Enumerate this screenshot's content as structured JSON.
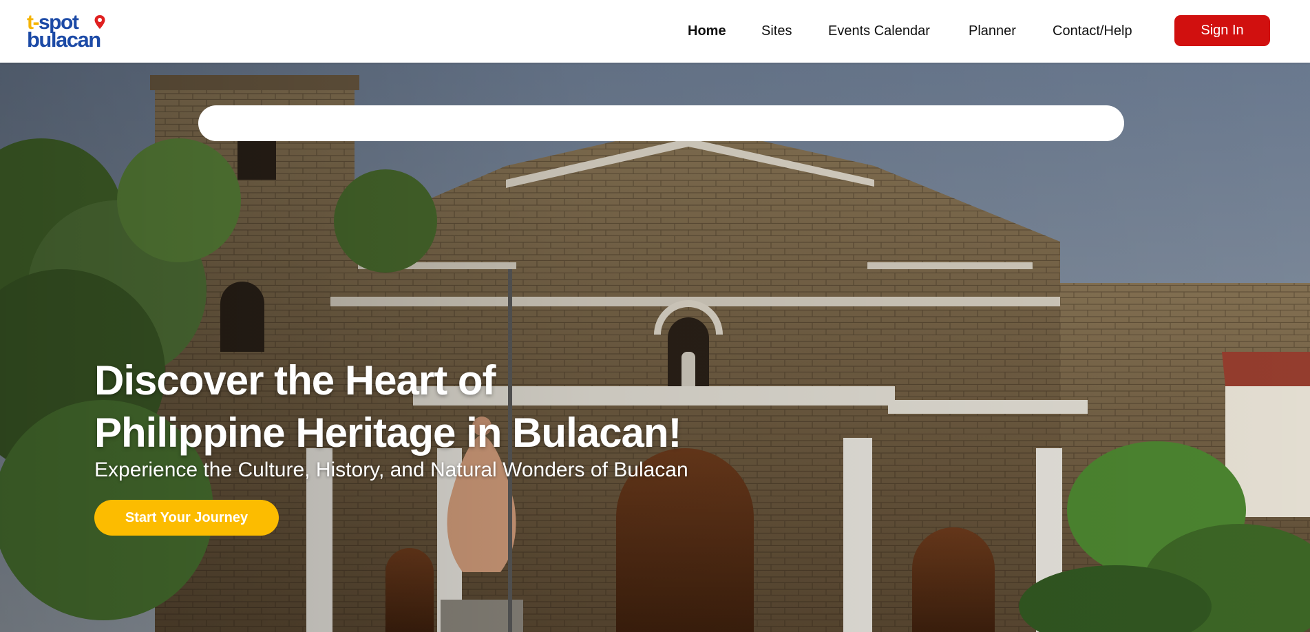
{
  "brand": {
    "logo_t": "t-",
    "logo_spot": "spot",
    "logo_place": "bulacan",
    "colors": {
      "yellow": "#f5b400",
      "blue": "#1c4aa6",
      "pin": "#e02020"
    },
    "pin_icon": "map-pin-icon"
  },
  "nav": {
    "items": [
      {
        "label": "Home",
        "active": true
      },
      {
        "label": "Sites",
        "active": false
      },
      {
        "label": "Events Calendar",
        "active": false
      },
      {
        "label": "Planner",
        "active": false
      },
      {
        "label": "Contact/Help",
        "active": false
      }
    ],
    "signin_label": "Sign In",
    "signin_color": "#d1100f"
  },
  "hero": {
    "search_placeholder": "",
    "headline_line1": "Discover the Heart of",
    "headline_line2": "Philippine Heritage in Bulacan!",
    "subheadline": "Experience the Culture, History, and Natural Wonders of Bulacan",
    "cta_label": "Start Your Journey",
    "cta_color": "#fcbc00",
    "background_image": "stone-church-facade-photo"
  }
}
